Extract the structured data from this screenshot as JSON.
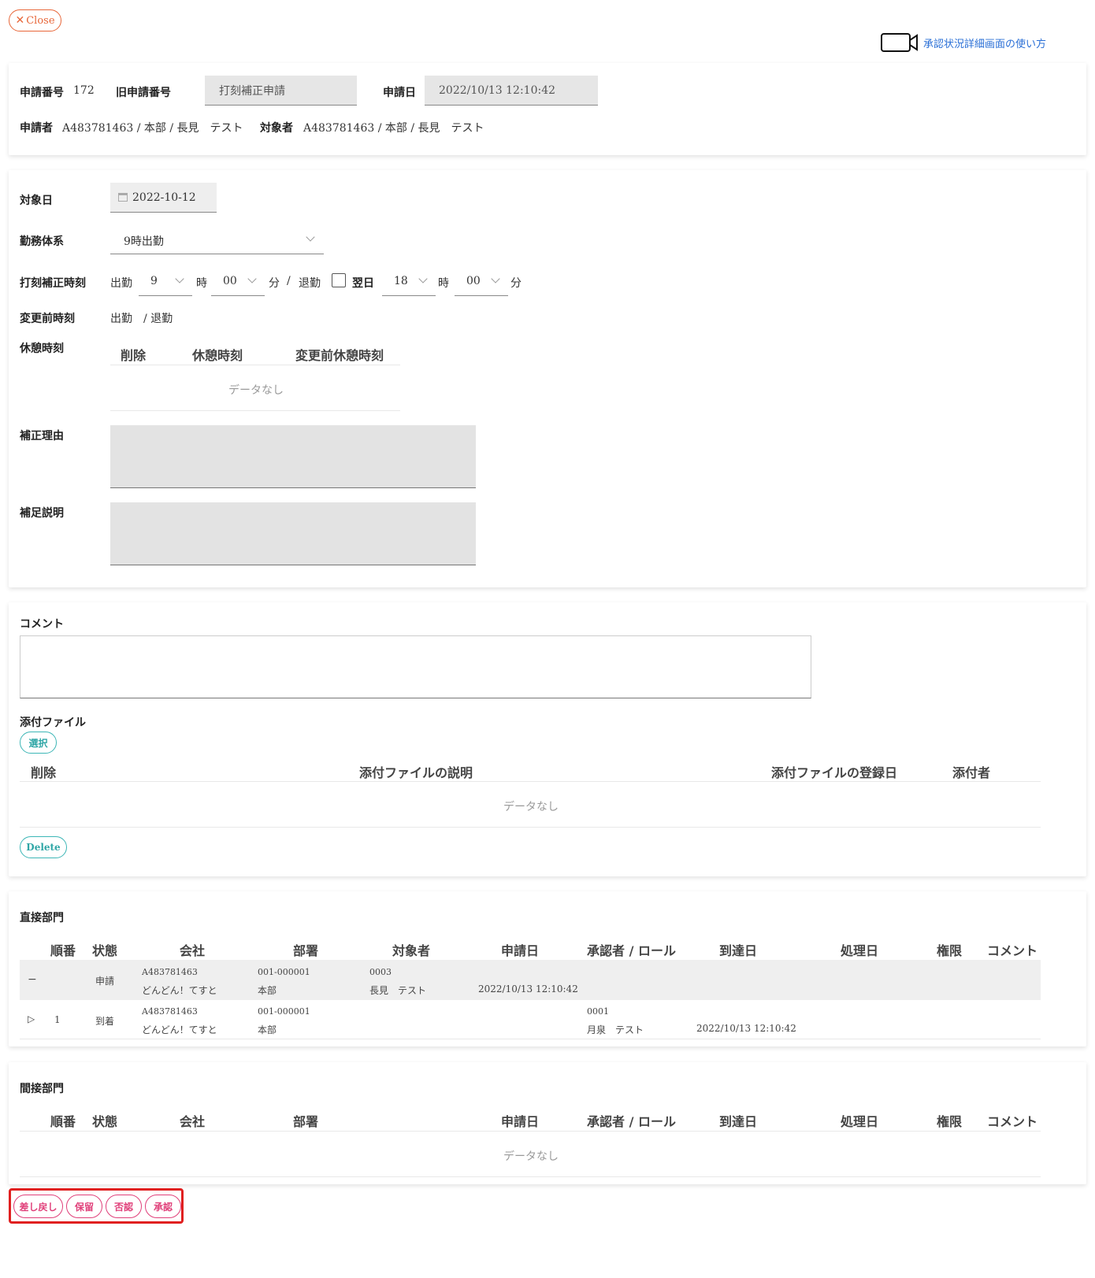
{
  "close_button": {
    "label": "Close"
  },
  "help_link": {
    "label": "承認状況詳細画面の使い方"
  },
  "header": {
    "app_no_label": "申請番号",
    "app_no_value": "172",
    "old_app_no_label": "旧申請番号",
    "app_type": "打刻補正申請",
    "app_date_label": "申請日",
    "app_date_value": "2022/10/13 12:10:42",
    "applicant_label": "申請者",
    "applicant_value": "A483781463 / 本部 / 長見　テスト",
    "target_label": "対象者",
    "target_value": "A483781463 / 本部 / 長見　テスト"
  },
  "form": {
    "target_date_label": "対象日",
    "target_date_value": "2022-10-12",
    "work_system_label": "勤務体系",
    "work_system_value": "9時出勤",
    "stamp_label": "打刻補正時刻",
    "in_label": "出勤",
    "in_hour": "9",
    "hour_unit": "時",
    "in_min": "00",
    "min_unit": "分",
    "slash": "/",
    "out_label": "退勤",
    "next_day_label": "翌日",
    "out_hour": "18",
    "out_min": "00",
    "before_label": "変更前時刻",
    "before_value": "出勤　/ 退勤",
    "break_label": "休憩時刻",
    "break_headers": [
      "削除",
      "休憩時刻",
      "変更前休憩時刻"
    ],
    "no_data": "データなし",
    "reason_label": "補正理由",
    "note_label": "補足説明"
  },
  "comment": {
    "label": "コメント",
    "attach_label": "添付ファイル",
    "select_button": "選択",
    "attach_headers": [
      "削除",
      "添付ファイルの説明",
      "添付ファイルの登録日",
      "添付者"
    ],
    "no_data": "データなし",
    "delete_button": "Delete"
  },
  "direct": {
    "title": "直接部門",
    "headers": [
      "順番",
      "状態",
      "会社",
      "部署",
      "対象者",
      "申請日",
      "承認者 / ロール",
      "到達日",
      "処理日",
      "権限",
      "コメント"
    ],
    "rows": [
      {
        "expander": "−",
        "order": "",
        "status": "申請",
        "company_code": "A483781463",
        "company_name": "どんどん！てすと",
        "dept_code": "001-000001",
        "dept_name": "本部",
        "target_code": "0003",
        "target_name": "長見　テスト",
        "app_date": "2022/10/13 12:10:42",
        "approver_code": "",
        "approver_name": "",
        "arrive": ""
      },
      {
        "expander": "▷",
        "order": "1",
        "status": "到着",
        "company_code": "A483781463",
        "company_name": "どんどん！てすと",
        "dept_code": "001-000001",
        "dept_name": "本部",
        "target_code": "",
        "target_name": "",
        "app_date": "",
        "approver_code": "0001",
        "approver_name": "月泉　テスト",
        "arrive": "2022/10/13 12:10:42"
      }
    ]
  },
  "indirect": {
    "title": "間接部門",
    "headers": [
      "順番",
      "状態",
      "会社",
      "部署",
      "申請日",
      "承認者 / ロール",
      "到達日",
      "処理日",
      "権限",
      "コメント"
    ],
    "no_data": "データなし"
  },
  "actions": {
    "sendback": "差し戻し",
    "hold": "保留",
    "reject": "否認",
    "approve": "承認"
  },
  "colors": {
    "close_orange": "#e8673a",
    "teal": "#3cb6b6",
    "pink": "#e0407a",
    "highlight_red": "#e02020"
  }
}
